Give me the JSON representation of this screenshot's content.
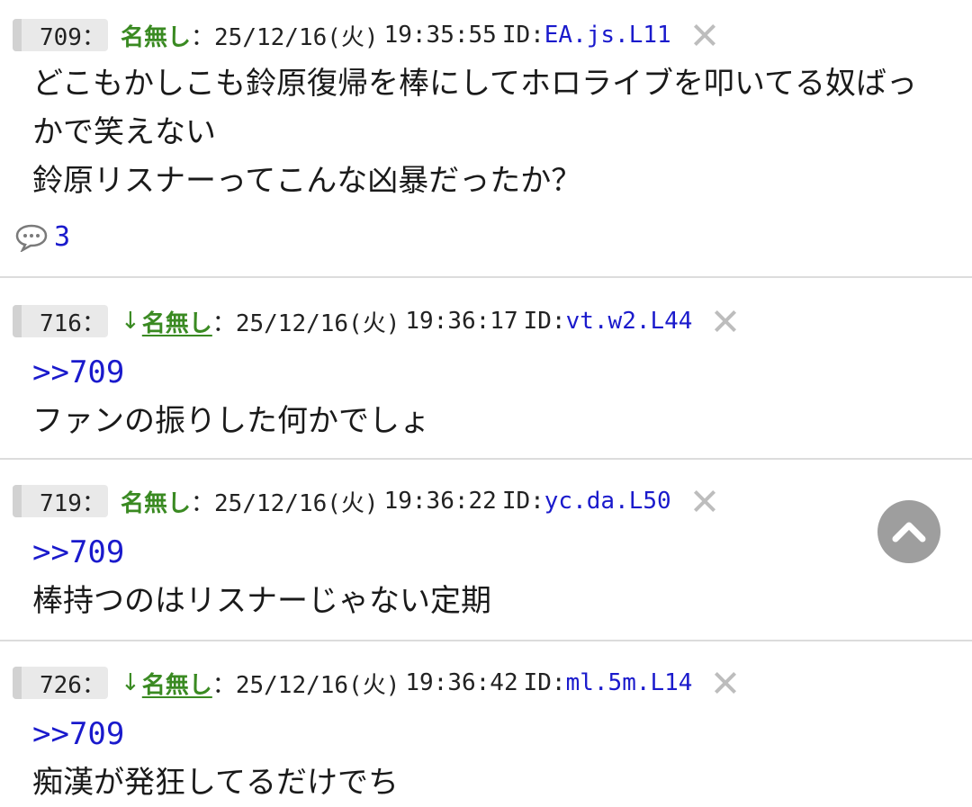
{
  "posts": [
    {
      "number": "709：",
      "reply_arrow": "",
      "name": "名無し",
      "sep": "：",
      "date": "25/12/16(火)",
      "time": "19:35:55",
      "id_label": "ID:",
      "id_value": "EA.js.L11",
      "anchor": "",
      "lines": [
        "どこもかしこも鈴原復帰を棒にしてホロライブを叩いてる奴ばっ",
        "かで笑えない",
        "鈴原リスナーってこんな凶暴だったか？"
      ],
      "reply_count": "3"
    },
    {
      "number": "716：",
      "reply_arrow": "↓",
      "name": "名無し",
      "sep": "：",
      "date": "25/12/16(火)",
      "time": "19:36:17",
      "id_label": "ID:",
      "id_value": "vt.w2.L44",
      "anchor": ">>709",
      "lines": [
        "ファンの振りした何かでしょ"
      ]
    },
    {
      "number": "719：",
      "reply_arrow": "",
      "name": "名無し",
      "sep": "：",
      "date": "25/12/16(火)",
      "time": "19:36:22",
      "id_label": "ID:",
      "id_value": "yc.da.L50",
      "anchor": ">>709",
      "lines": [
        "棒持つのはリスナーじゃない定期"
      ]
    },
    {
      "number": "726：",
      "reply_arrow": "↓",
      "name": "名無し",
      "sep": "：",
      "date": "25/12/16(火)",
      "time": "19:36:42",
      "id_label": "ID:",
      "id_value": "ml.5m.L14",
      "anchor": ">>709",
      "lines": [
        "痴漢が発狂してるだけでち"
      ]
    }
  ],
  "icons": {
    "close": "close-icon",
    "comment": "comment-bubble-icon",
    "scroll_top": "chevron-up-icon"
  },
  "colors": {
    "name_green": "#3a8a22",
    "id_blue": "#1a1acc",
    "divider": "#dcdcdc",
    "scroll_button": "#9e9e9e"
  }
}
